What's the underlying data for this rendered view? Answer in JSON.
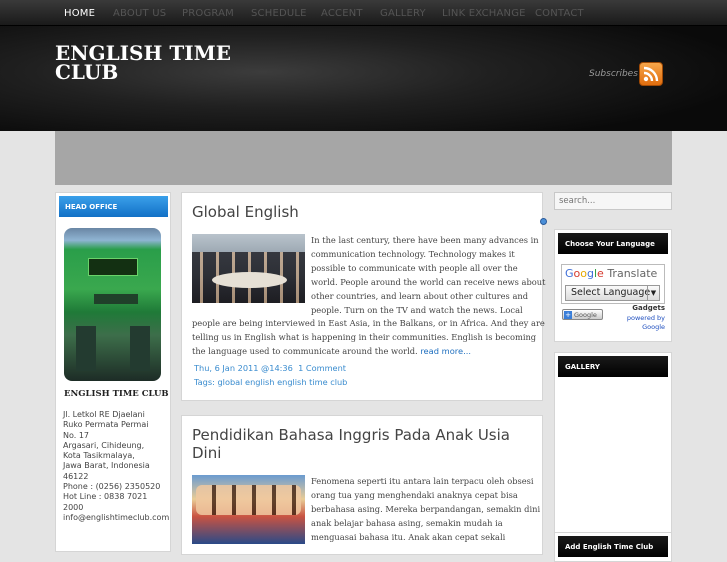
{
  "nav": {
    "items": [
      "HOME",
      "ABOUT US",
      "PROGRAM",
      "SCHEDULE",
      "ACCENT",
      "GALLERY",
      "LINK EXCHANGE",
      "CONTACT"
    ],
    "active": "HOME"
  },
  "site": {
    "title_line1": "ENGLISH TIME",
    "title_line2": "CLUB",
    "subscribe_label": "Subscribes"
  },
  "sidebar_left": {
    "heading": "HEAD OFFICE",
    "name": "ENGLISH TIME CLUB",
    "address": [
      "Jl. Letkol RE Djaelani",
      "Ruko Permata Permai",
      "No. 17",
      "Argasari, Cihideung,",
      "Kota Tasikmalaya,",
      "Jawa Barat, Indonesia",
      "46122",
      "Phone : (0256) 2350520",
      "Hot Line : 0838 7021",
      "2000",
      "info@englishtimeclub.com"
    ]
  },
  "posts": [
    {
      "title": "Global English",
      "lines_beside": [
        "In the last century, there have been many advances in",
        "communication technology. Technology makes it",
        "possible to communicate with people all over the",
        "world. People around the world can receive news about",
        "other countries, and learn about other cultures and",
        "people. Turn on the TV and watch the news. Local"
      ],
      "lines_full": [
        "people are being interviewed in East Asia, in the Balkans, or in Africa. And they are",
        "telling us in English what is happening in their communities. English is becoming"
      ],
      "last_line": "the language used to communicate around the world.",
      "read_more": "read more...",
      "date": "Thu, 6 Jan 2011 @14:36",
      "comments": "1 Comment",
      "tags": "Tags: global english english time club"
    },
    {
      "title_line1": "Pendidikan Bahasa Inggris Pada Anak Usia",
      "title_line2": "Dini",
      "lines_beside": [
        "Fenomena seperti itu antara lain terpacu oleh obsesi",
        "orang tua yang menghendaki anaknya cepat bisa",
        "berbahasa asing. Mereka berpandangan, semakin dini",
        "anak belajar bahasa asing, semakin mudah ia",
        "menguasai bahasa itu. Anak akan cepat sekali"
      ]
    }
  ],
  "sidebar_right": {
    "search_placeholder": "search...",
    "language_heading": "Choose Your Language",
    "translate_brand": "Translate",
    "select_value": "Select Language",
    "gadget_button": "Google",
    "gadgets_label": "Gadgets",
    "powered_by": "powered by",
    "powered_google": "Google",
    "gallery_heading": "GALLERY",
    "add_heading": "Add English Time Club"
  },
  "colors": {
    "link": "#1f6fbf",
    "meta": "#3a8ccf",
    "head_office_blue": "#1270c6"
  }
}
